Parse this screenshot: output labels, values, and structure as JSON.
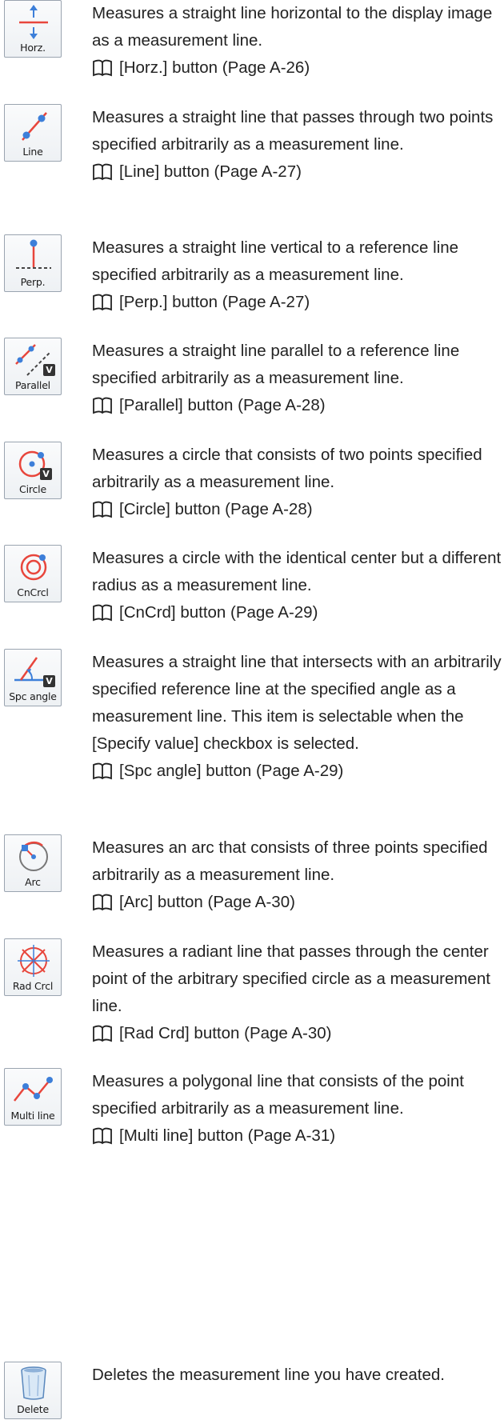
{
  "colors": {
    "accent": "#e8463c",
    "blue": "#3d7fd9",
    "border": "#9aa4b0"
  },
  "entries": [
    {
      "icon": "horizontal-line-icon",
      "button_label": "Horz.",
      "description": "Measures a straight line horizontal to the display image as a measurement line.",
      "reference": "[Horz.] button (Page A-26)"
    },
    {
      "icon": "line-icon",
      "button_label": "Line",
      "description": "Measures a straight line that passes through two points specified arbitrarily as a measurement line.",
      "reference": "[Line] button (Page A-27)"
    },
    {
      "icon": "perpendicular-icon",
      "button_label": "Perp.",
      "description": "Measures a straight line vertical to a reference line specified arbitrarily as a measurement line.",
      "reference": "[Perp.] button (Page A-27)"
    },
    {
      "icon": "parallel-icon",
      "button_label": "Parallel",
      "badge": "V",
      "description": "Measures a straight line parallel to a reference line specified arbitrarily as a measurement line.",
      "reference": "[Parallel] button (Page A-28)"
    },
    {
      "icon": "circle-icon",
      "button_label": "Circle",
      "badge": "V",
      "description": "Measures a circle that consists of two points specified arbitrarily as a measurement line.",
      "reference": "[Circle] button (Page A-28)"
    },
    {
      "icon": "concentric-circle-icon",
      "button_label": "CnCrcl",
      "description": "Measures a circle with the identical center but a different radius as a measurement line.",
      "reference": "[CnCrd] button (Page A-29)"
    },
    {
      "icon": "specified-angle-icon",
      "button_label": "Spc angle",
      "badge": "V",
      "description": "Measures a straight line that intersects with an arbitrarily specified reference line at the specified angle as a measurement line. This item is selectable when the [Specify value] checkbox is selected.",
      "reference": "[Spc angle] button (Page A-29)"
    },
    {
      "icon": "arc-icon",
      "button_label": "Arc",
      "description": "Measures an arc that consists of three points specified arbitrarily as a measurement line.",
      "reference": "[Arc] button (Page A-30)"
    },
    {
      "icon": "radiant-circle-icon",
      "button_label": "Rad Crcl",
      "description": "Measures a radiant line that passes through the center point of the arbitrary specified circle as a measurement line.",
      "reference": "[Rad Crd] button (Page A-30)"
    },
    {
      "icon": "multi-line-icon",
      "button_label": "Multi line",
      "description": "Measures a polygonal line that consists of the point specified arbitrarily as a measurement line.",
      "reference": "[Multi line] button (Page A-31)"
    },
    {
      "icon": "trash-can-icon",
      "button_label": "Delete",
      "description": "Deletes the measurement line you have created.",
      "reference": ""
    }
  ]
}
